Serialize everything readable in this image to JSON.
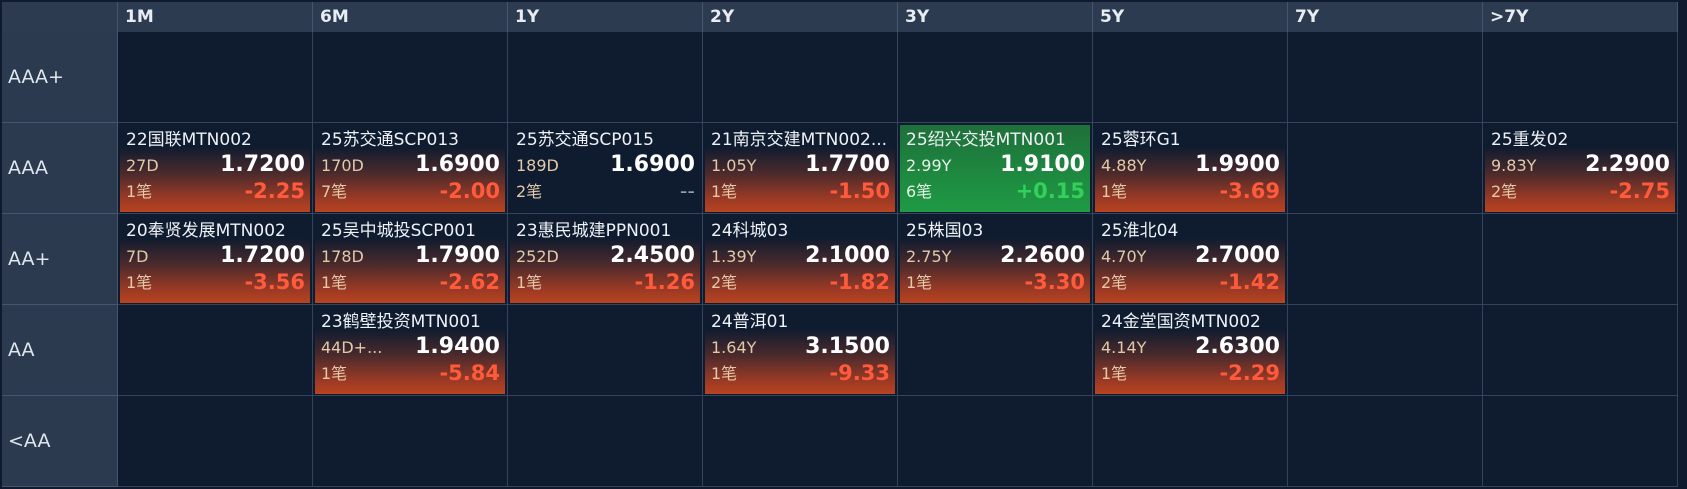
{
  "columns": [
    "1M",
    "6M",
    "1Y",
    "2Y",
    "3Y",
    "5Y",
    "7Y",
    ">7Y"
  ],
  "rows": [
    "AAA+",
    "AAA",
    "AA+",
    "AA",
    "<AA"
  ],
  "cells": [
    {
      "row": 1,
      "col": 0,
      "name": "22国联MTN002",
      "term": "27D",
      "price": "1.7200",
      "count": "1笔",
      "change": "-2.25",
      "trend": "down"
    },
    {
      "row": 1,
      "col": 1,
      "name": "25苏交通SCP013",
      "term": "170D",
      "price": "1.6900",
      "count": "7笔",
      "change": "-2.00",
      "trend": "down"
    },
    {
      "row": 1,
      "col": 2,
      "name": "25苏交通SCP015",
      "term": "189D",
      "price": "1.6900",
      "count": "2笔",
      "change": "--",
      "trend": "flat"
    },
    {
      "row": 1,
      "col": 3,
      "name": "21南京交建MTN002...",
      "term": "1.05Y",
      "price": "1.7700",
      "count": "1笔",
      "change": "-1.50",
      "trend": "down"
    },
    {
      "row": 1,
      "col": 4,
      "name": "25绍兴交投MTN001",
      "term": "2.99Y",
      "price": "1.9100",
      "count": "6笔",
      "change": "+0.15",
      "trend": "up"
    },
    {
      "row": 1,
      "col": 5,
      "name": "25蓉环G1",
      "term": "4.88Y",
      "price": "1.9900",
      "count": "1笔",
      "change": "-3.69",
      "trend": "down"
    },
    {
      "row": 1,
      "col": 7,
      "name": "25重发02",
      "term": "9.83Y",
      "price": "2.2900",
      "count": "2笔",
      "change": "-2.75",
      "trend": "down"
    },
    {
      "row": 2,
      "col": 0,
      "name": "20奉贤发展MTN002",
      "term": "7D",
      "price": "1.7200",
      "count": "1笔",
      "change": "-3.56",
      "trend": "down"
    },
    {
      "row": 2,
      "col": 1,
      "name": "25吴中城投SCP001",
      "term": "178D",
      "price": "1.7900",
      "count": "1笔",
      "change": "-2.62",
      "trend": "down"
    },
    {
      "row": 2,
      "col": 2,
      "name": "23惠民城建PPN001",
      "term": "252D",
      "price": "2.4500",
      "count": "1笔",
      "change": "-1.26",
      "trend": "down"
    },
    {
      "row": 2,
      "col": 3,
      "name": "24科城03",
      "term": "1.39Y",
      "price": "2.1000",
      "count": "2笔",
      "change": "-1.82",
      "trend": "down"
    },
    {
      "row": 2,
      "col": 4,
      "name": "25株国03",
      "term": "2.75Y",
      "price": "2.2600",
      "count": "1笔",
      "change": "-3.30",
      "trend": "down"
    },
    {
      "row": 2,
      "col": 5,
      "name": "25淮北04",
      "term": "4.70Y",
      "price": "2.7000",
      "count": "2笔",
      "change": "-1.42",
      "trend": "down"
    },
    {
      "row": 3,
      "col": 1,
      "name": "23鹤壁投资MTN001",
      "term": "44D+...",
      "price": "1.9400",
      "count": "1笔",
      "change": "-5.84",
      "trend": "down"
    },
    {
      "row": 3,
      "col": 3,
      "name": "24普洱01",
      "term": "1.64Y",
      "price": "3.1500",
      "count": "1笔",
      "change": "-9.33",
      "trend": "down"
    },
    {
      "row": 3,
      "col": 5,
      "name": "24金堂国资MTN002",
      "term": "4.14Y",
      "price": "2.6300",
      "count": "1笔",
      "change": "-2.29",
      "trend": "down"
    }
  ]
}
